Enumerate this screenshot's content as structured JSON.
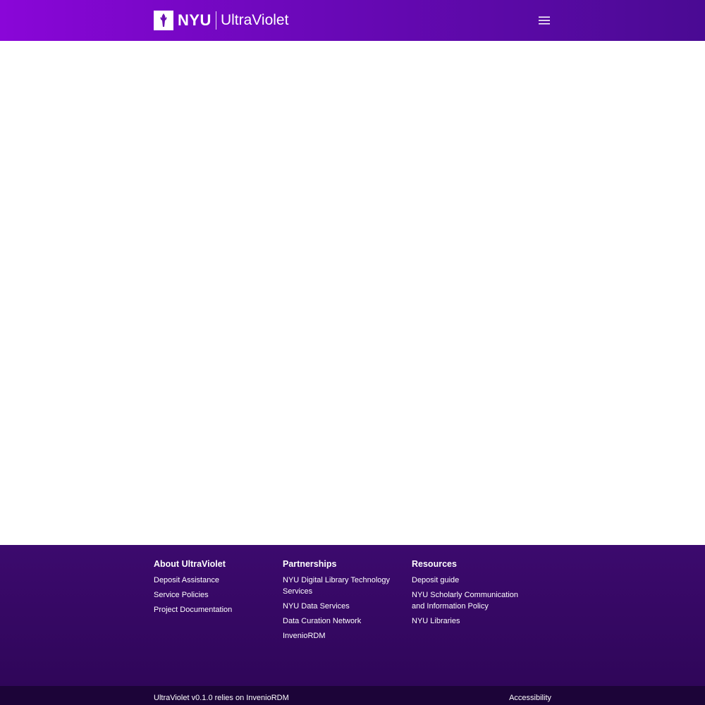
{
  "header": {
    "brand_nyu": "NYU",
    "brand_product": "UltraViolet",
    "logo_icon": "nyu-torch-icon",
    "menu_icon": "hamburger-menu-icon",
    "colors": {
      "gradient_start": "#8a06d8",
      "gradient_end": "#4a0a93"
    }
  },
  "footer": {
    "columns": [
      {
        "title": "About UltraViolet",
        "links": [
          "Deposit Assistance",
          "Service Policies",
          "Project Documentation"
        ]
      },
      {
        "title": "Partnerships",
        "links": [
          "NYU Digital Library Technology Services",
          "NYU Data Services",
          "Data Curation Network",
          "InvenioRDM"
        ]
      },
      {
        "title": "Resources",
        "links": [
          "Deposit guide",
          "NYU Scholarly Communication and Information Policy",
          "NYU Libraries"
        ]
      }
    ],
    "bottom": {
      "version_text": "UltraViolet v0.1.0 relies on InvenioRDM",
      "accessibility": "Accessibility"
    },
    "colors": {
      "background": "#3c0a6e",
      "bottom_bar": "#1c0438"
    }
  }
}
